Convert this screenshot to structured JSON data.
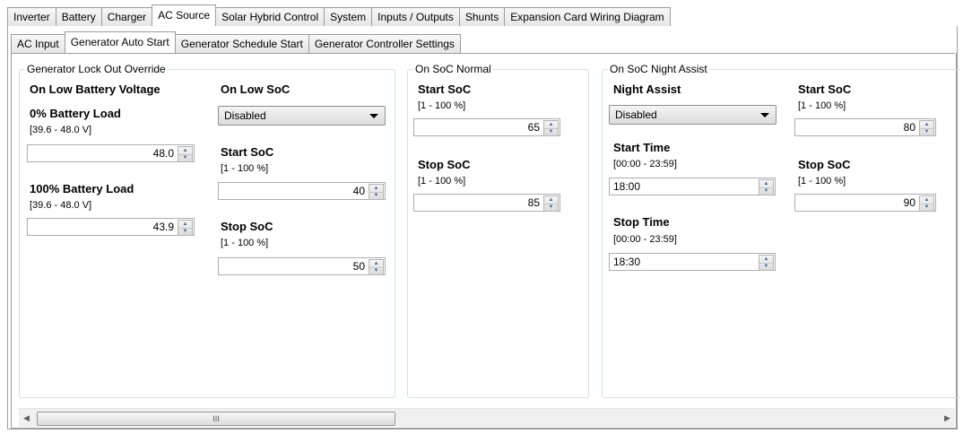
{
  "tabs": [
    "Inverter",
    "Battery",
    "Charger",
    "AC Source",
    "Solar Hybrid Control",
    "System",
    "Inputs / Outputs",
    "Shunts",
    "Expansion Card Wiring Diagram"
  ],
  "active_tab": "AC Source",
  "subtabs": [
    "AC Input",
    "Generator Auto Start",
    "Generator Schedule Start",
    "Generator Controller Settings"
  ],
  "active_subtab": "Generator Auto Start",
  "lockout": {
    "legend": "Generator Lock Out Override",
    "low_voltage_title": "On Low Battery Voltage",
    "load0_label": "0% Battery Load",
    "load0_range": "[39.6 - 48.0 V]",
    "load0_value": "48.0",
    "load100_label": "100% Battery Load",
    "load100_range": "[39.6 - 48.0 V]",
    "load100_value": "43.9",
    "low_soc_title": "On Low SoC",
    "low_soc_select": "Disabled",
    "start_label": "Start SoC",
    "start_range": "[1 - 100 %]",
    "start_value": "40",
    "stop_label": "Stop SoC",
    "stop_range": "[1 - 100 %]",
    "stop_value": "50"
  },
  "normal": {
    "legend": "On SoC Normal",
    "start_label": "Start SoC",
    "start_range": "[1 - 100 %]",
    "start_value": "65",
    "stop_label": "Stop SoC",
    "stop_range": "[1 - 100 %]",
    "stop_value": "85"
  },
  "night": {
    "legend": "On SoC Night Assist",
    "assist_title": "Night Assist",
    "assist_select": "Disabled",
    "start_time_label": "Start Time",
    "start_time_range": "[00:00 - 23:59]",
    "start_time_value": "18:00",
    "stop_time_label": "Stop Time",
    "stop_time_range": "[00:00 - 23:59]",
    "stop_time_value": "18:30",
    "start_soc_label": "Start SoC",
    "start_soc_range": "[1 - 100 %]",
    "start_soc_value": "80",
    "stop_soc_label": "Stop SoC",
    "stop_soc_range": "[1 - 100 %]",
    "stop_soc_value": "90"
  },
  "scrollbar": {
    "grip": "III"
  },
  "icons": {
    "spin_up": "up-arrow-icon",
    "spin_down": "down-arrow-icon",
    "dropdown": "chevron-down-icon",
    "scroll_left": "scroll-left-icon",
    "scroll_right": "scroll-right-icon"
  }
}
